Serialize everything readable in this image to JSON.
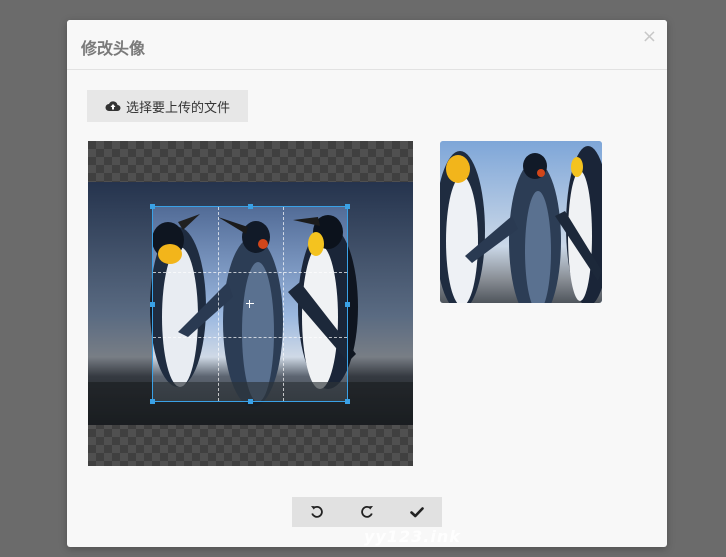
{
  "dialog": {
    "title": "修改头像",
    "close_label": "×"
  },
  "upload": {
    "label": "选择要上传的文件",
    "icon": "cloud-upload-icon"
  },
  "editor": {
    "image_subject": "penguins",
    "accent_color": "#3aa1e6"
  },
  "actions": {
    "rotate_left_icon": "rotate-left-icon",
    "rotate_right_icon": "rotate-right-icon",
    "confirm_icon": "check-icon"
  },
  "watermark": "yy123.ink"
}
